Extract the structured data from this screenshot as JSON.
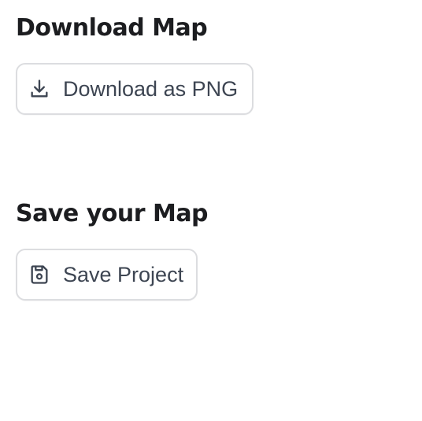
{
  "download_section": {
    "title": "Download Map",
    "button": {
      "label": "Download as PNG",
      "icon": "download-icon"
    }
  },
  "save_section": {
    "title": "Save your Map",
    "button": {
      "label": "Save Project",
      "icon": "save-icon"
    }
  },
  "colors": {
    "heading": "#1c1d20",
    "button_text": "#3d4552",
    "button_border": "#dcdde0",
    "background": "#ffffff"
  }
}
